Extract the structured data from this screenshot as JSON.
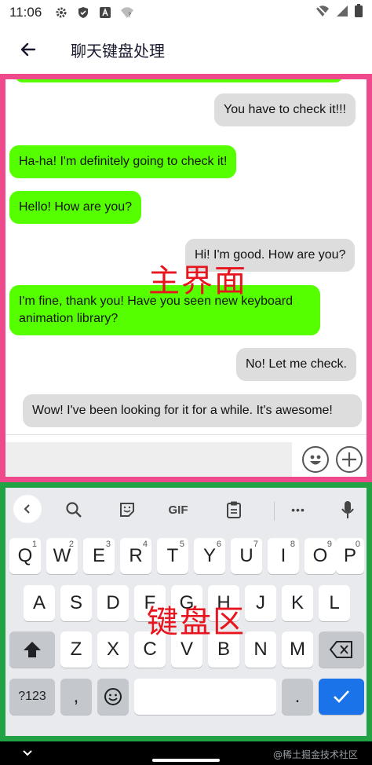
{
  "status_bar": {
    "time": "11:06"
  },
  "app_bar": {
    "title": "聊天键盘处理"
  },
  "chat": {
    "messages": [
      {
        "side": "out",
        "text": "You have to check it!!!"
      },
      {
        "side": "in",
        "text": "Ha-ha! I'm definitely going to check it!"
      },
      {
        "side": "in",
        "text": "Hello! How are you?"
      },
      {
        "side": "out",
        "text": "Hi! I'm good. How are you?"
      },
      {
        "side": "in",
        "text": "I'm fine, thank you! Have you seen new keyboard animation library?"
      },
      {
        "side": "out",
        "text": "No! Let me check."
      },
      {
        "side": "out",
        "text": "Wow! I've been looking for it for a while. It's awesome!"
      }
    ],
    "input_value": "",
    "main_label": "主界面"
  },
  "keyboard": {
    "label": "键盘区",
    "toolbar": {
      "gif": "GIF",
      "more": "•••"
    },
    "row1": [
      "Q",
      "W",
      "E",
      "R",
      "T",
      "Y",
      "U",
      "I",
      "O",
      "P"
    ],
    "row1_hints": [
      "1",
      "2",
      "3",
      "4",
      "5",
      "6",
      "7",
      "8",
      "9",
      "0"
    ],
    "row2": [
      "A",
      "S",
      "D",
      "F",
      "G",
      "H",
      "J",
      "K",
      "L"
    ],
    "row3": [
      "Z",
      "X",
      "C",
      "V",
      "B",
      "N",
      "M"
    ],
    "sym_key": "?123",
    "comma": ",",
    "period": "."
  },
  "watermark": "@稀土掘金技术社区",
  "colors": {
    "incoming_bubble": "#55ff00",
    "outgoing_bubble": "#dddddd",
    "main_frame": "#ee4a8b",
    "keyboard_frame": "#21a244",
    "label_red": "#e8141e",
    "enter_key": "#1a73e8"
  }
}
